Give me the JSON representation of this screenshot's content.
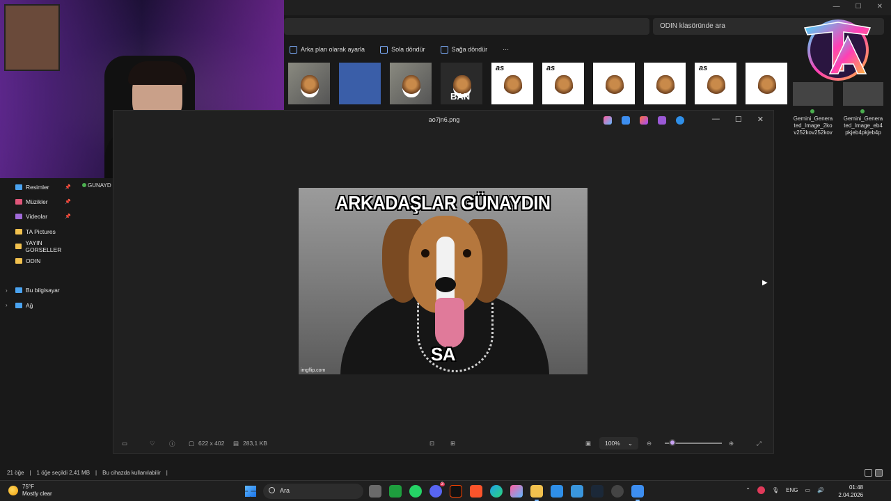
{
  "explorer": {
    "search_placeholder": "ODIN klasöründe ara",
    "commands": [
      "Arka plan olarak ayarla",
      "Sola döndür",
      "Sağa döndür",
      "⋯"
    ],
    "thumbnail_captions": [
      "as",
      "as",
      "as"
    ],
    "thumbnail_ban": "BAN",
    "gemini_files": [
      "Gemini_Genera ted_Image_2ko v252kov252kov",
      "Gemini_Genera ted_Image_eb4 pkjeb4pkjeb4p"
    ],
    "left_file": "GUNAYD ODIN",
    "sidebar": [
      {
        "label": "Resimler",
        "color": "#4aa3f0",
        "pinned": true
      },
      {
        "label": "Müzikler",
        "color": "#e0567a",
        "pinned": true
      },
      {
        "label": "Videolar",
        "color": "#a06ad8",
        "pinned": true
      },
      {
        "label": "TA Pictures",
        "color": "#f2c14e",
        "pinned": false
      },
      {
        "label": "YAYIN GORSELLER",
        "color": "#f2c14e",
        "pinned": false
      },
      {
        "label": "ODIN",
        "color": "#f2c14e",
        "pinned": false
      },
      {
        "label": "Bu bilgisayar",
        "color": "#4aa3f0",
        "pinned": false
      },
      {
        "label": "Ağ",
        "color": "#4aa3f0",
        "pinned": false
      }
    ],
    "status": [
      "21 öğe",
      "1 öğe seçildi  2,41 MB",
      "Bu cihazda kullanılabilir"
    ]
  },
  "viewer": {
    "title": "ao7jn6.png",
    "dimensions": "622 x 402",
    "size": "283,1 KB",
    "zoom": "100%",
    "zoom_level": 0.08,
    "meme_top": "ARKADAŞLAR GÜNAYDIN",
    "meme_bottom": "SA",
    "watermark": "imgflip.com"
  },
  "taskbar": {
    "temperature": "75°F",
    "condition": "Mostly clear",
    "search": "Ara",
    "language": "ENG",
    "time": "01:48",
    "date": "2.04.2026",
    "notification_badge": "3"
  },
  "colors": {
    "accent": "#c9a3f5",
    "folder": "#f2c14e"
  }
}
